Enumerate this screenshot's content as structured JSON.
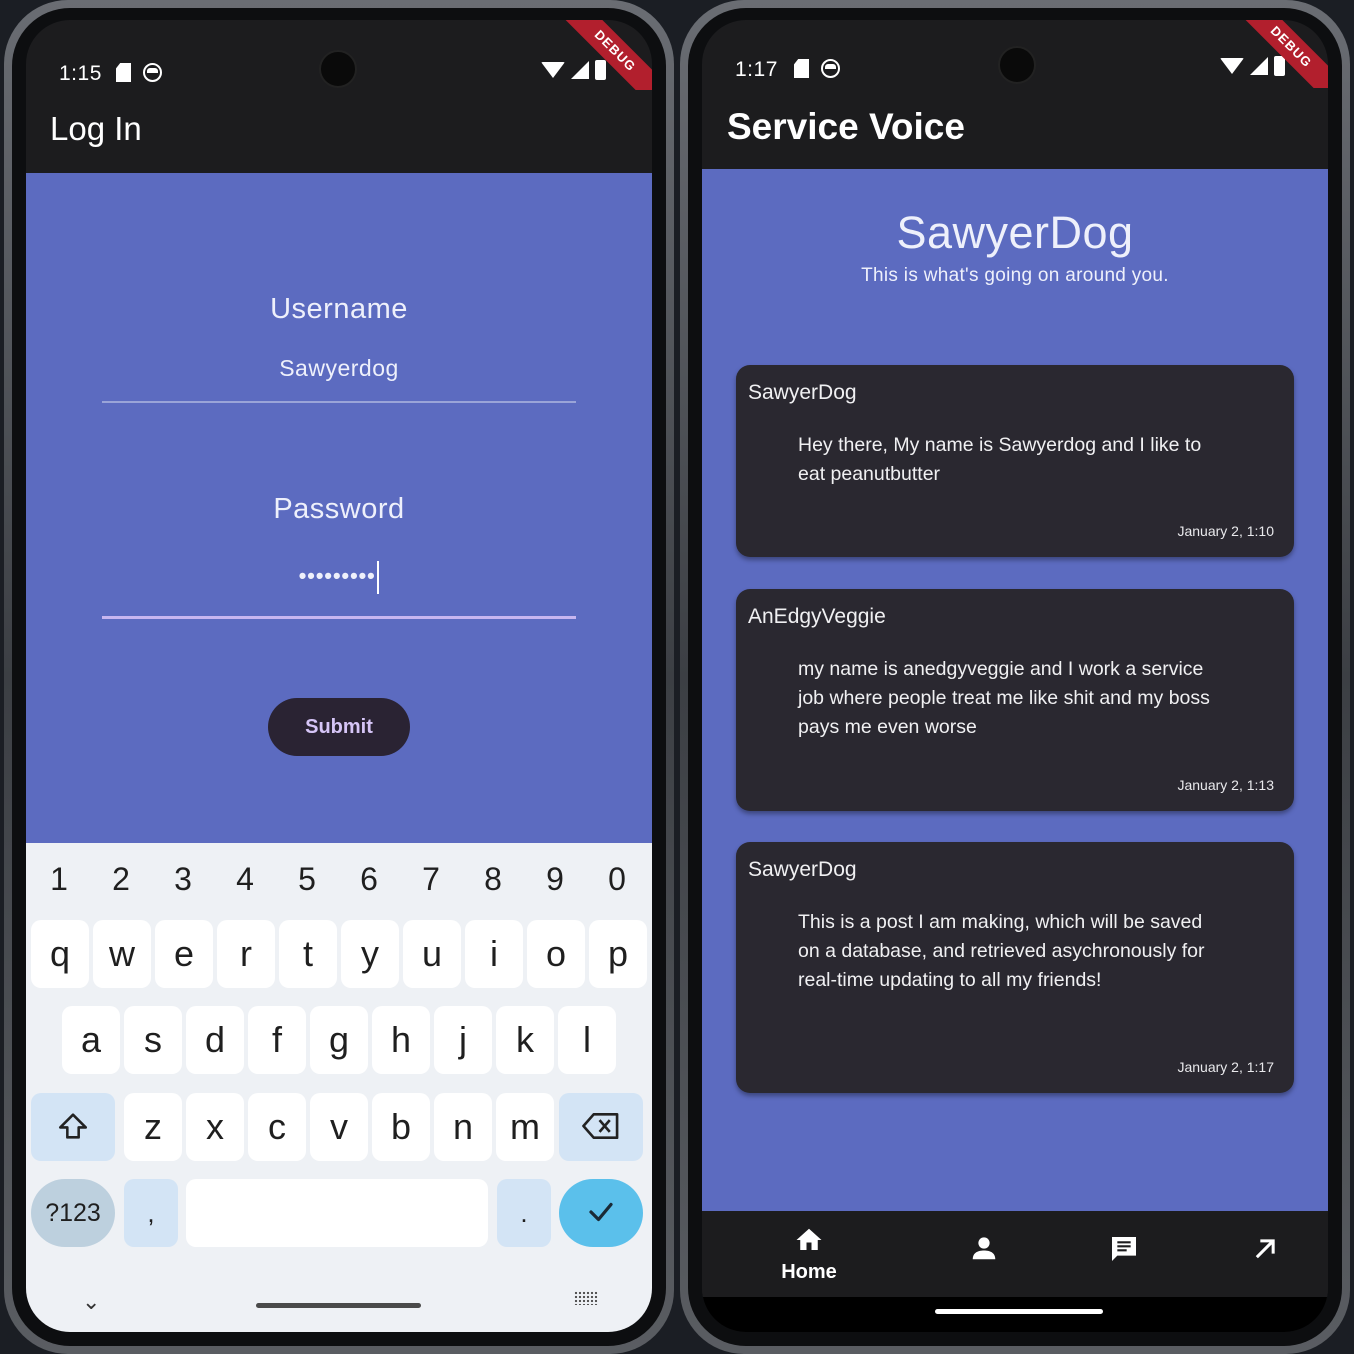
{
  "left": {
    "status": {
      "time": "1:15",
      "debug_label": "DEBUG"
    },
    "app_bar": {
      "title": "Log In"
    },
    "form": {
      "username_label": "Username",
      "username_value": "Sawyerdog",
      "password_label": "Password",
      "password_value": "•••••••••",
      "submit_label": "Submit"
    },
    "keyboard": {
      "numbers": [
        "1",
        "2",
        "3",
        "4",
        "5",
        "6",
        "7",
        "8",
        "9",
        "0"
      ],
      "row1": [
        "q",
        "w",
        "e",
        "r",
        "t",
        "y",
        "u",
        "i",
        "o",
        "p"
      ],
      "row2": [
        "a",
        "s",
        "d",
        "f",
        "g",
        "h",
        "j",
        "k",
        "l"
      ],
      "row3": [
        "z",
        "x",
        "c",
        "v",
        "b",
        "n",
        "m"
      ],
      "symbols_label": "?123",
      "comma_label": ",",
      "period_label": "."
    }
  },
  "right": {
    "status": {
      "time": "1:17",
      "debug_label": "DEBUG"
    },
    "app_bar": {
      "title": "Service Voice"
    },
    "header": {
      "username": "SawyerDog",
      "subtitle": "This is what's going on around you."
    },
    "posts": [
      {
        "author": "SawyerDog",
        "text": "Hey there, My name is Sawyerdog and I like to eat peanutbutter",
        "date": "January 2, 1:10"
      },
      {
        "author": "AnEdgyVeggie",
        "text": "my name is anedgyveggie and I work a service job where people treat me like shit and my boss pays me even worse",
        "date": "January 2, 1:13"
      },
      {
        "author": "SawyerDog",
        "text": "This is a post I am making, which will be saved on a database, and retrieved asychronously for real-time updating to all my friends!",
        "date": "January 2, 1:17"
      }
    ],
    "nav": {
      "home_label": "Home",
      "items": [
        "home-icon",
        "person-icon",
        "message-icon",
        "arrow-up-right-icon"
      ]
    }
  },
  "colors": {
    "primary": "#5c6bc0",
    "card": "#2a2830",
    "app_bar": "#1c1c1e",
    "debug_banner": "#b21f2d",
    "submit_text": "#d6c5f7",
    "enter_key": "#5bc0eb"
  }
}
